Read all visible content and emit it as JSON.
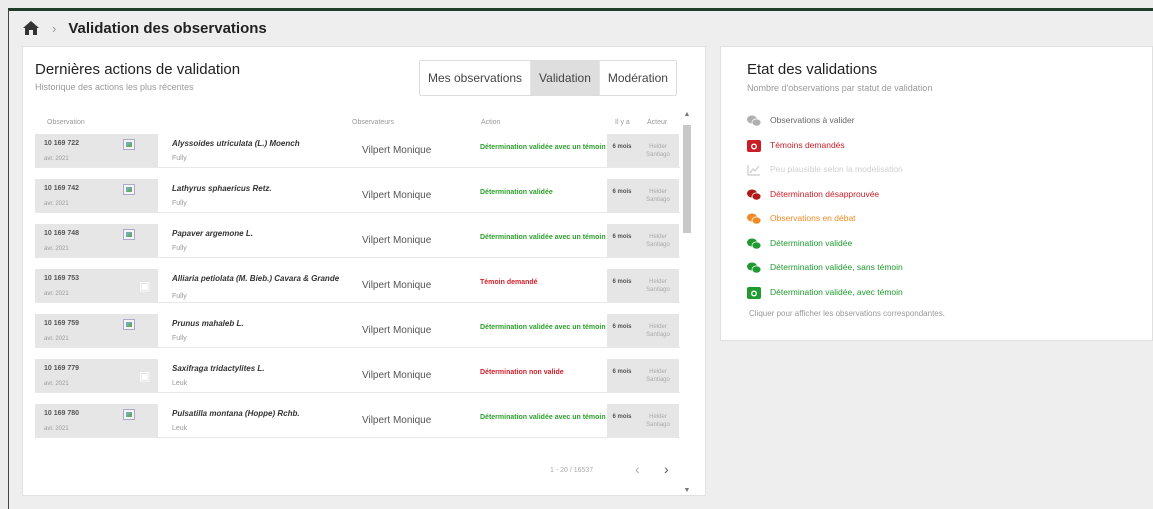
{
  "breadcrumb": {
    "title": "Validation des observations"
  },
  "left": {
    "title": "Dernières actions de validation",
    "subtitle": "Historique des actions les plus récentes",
    "tabs": [
      "Mes observations",
      "Validation",
      "Modération"
    ],
    "active_tab": "Validation",
    "columns": [
      "Observation",
      "Observateurs",
      "Action",
      "Il y a",
      "Acteur"
    ],
    "rows": [
      {
        "id": "10 169 722",
        "date": "avr. 2021",
        "species": "Alyssoides utriculata (L.) Moench",
        "place": "Fully",
        "observer": "Vilpert Monique",
        "action": "Détermination validée avec un témoin",
        "status": "green",
        "ago": "6 mois",
        "actor": "Helder Santiago",
        "media": "image"
      },
      {
        "id": "10 169 742",
        "date": "avr. 2021",
        "species": "Lathyrus sphaericus Retz.",
        "place": "Fully",
        "observer": "Vilpert Monique",
        "action": "Détermination validée",
        "status": "green",
        "ago": "6 mois",
        "actor": "Helder Santiago",
        "media": "image"
      },
      {
        "id": "10 169 748",
        "date": "avr. 2021",
        "species": "Papaver argemone L.",
        "place": "Fully",
        "observer": "Vilpert Monique",
        "action": "Détermination validée avec un témoin",
        "status": "green",
        "ago": "6 mois",
        "actor": "Helder Santiago",
        "media": "image"
      },
      {
        "id": "10 169 753",
        "date": "avr. 2021",
        "species": "Alliaria petiolata (M. Bieb.) Cavara & Grande",
        "place": "Fully",
        "observer": "Vilpert Monique",
        "action": "Témoin demandé",
        "status": "red",
        "ago": "6 mois",
        "actor": "Helder Santiago",
        "media": "camera"
      },
      {
        "id": "10 169 759",
        "date": "avr. 2021",
        "species": "Prunus mahaleb L.",
        "place": "Fully",
        "observer": "Vilpert Monique",
        "action": "Détermination validée avec un témoin",
        "status": "green",
        "ago": "6 mois",
        "actor": "Helder Santiago",
        "media": "image"
      },
      {
        "id": "10 169 779",
        "date": "avr. 2021",
        "species": "Saxifraga tridactylites L.",
        "place": "Leuk",
        "observer": "Vilpert Monique",
        "action": "Détermination non valide",
        "status": "red",
        "ago": "6 mois",
        "actor": "Helder Santiago",
        "media": "camera"
      },
      {
        "id": "10 169 780",
        "date": "avr. 2021",
        "species": "Pulsatilla montana (Hoppe) Rchb.",
        "place": "Leuk",
        "observer": "Vilpert Monique",
        "action": "Détermination validée avec un témoin",
        "status": "green",
        "ago": "6 mois",
        "actor": "Helder Santiago",
        "media": "image"
      }
    ],
    "pager": "1 - 20 / 16537"
  },
  "right": {
    "title": "Etat des validations",
    "subtitle": "Nombre d'observations par statut de validation",
    "items": [
      {
        "label": "Observations à valider",
        "color": "#666666",
        "icon": "chat-bubbles-icon",
        "icon_color": "#b0b0b0"
      },
      {
        "label": "Témoins demandés",
        "color": "#c81e28",
        "icon": "camera-icon",
        "icon_color": "#c81e28"
      },
      {
        "label": "Peu plausible selon la modélisation",
        "color": "#cfcfcf",
        "icon": "chart-icon",
        "icon_color": "#cccccc"
      },
      {
        "label": "Détermination désapprouvée",
        "color": "#c81e28",
        "icon": "chat-bubbles-icon",
        "icon_color": "#b01818"
      },
      {
        "label": "Observations en débat",
        "color": "#f08a24",
        "icon": "chat-bubbles-icon",
        "icon_color": "#f08a24"
      },
      {
        "label": "Détermination validée",
        "color": "#1f9a2e",
        "icon": "chat-bubbles-icon",
        "icon_color": "#1f9a2e"
      },
      {
        "label": "Détermination validée, sans témoin",
        "color": "#1f9a2e",
        "icon": "chat-bubbles-icon",
        "icon_color": "#1f9a2e"
      },
      {
        "label": "Détermination validée, avec témoin",
        "color": "#1f9a2e",
        "icon": "camera-icon",
        "icon_color": "#1f9a2e"
      }
    ],
    "hint": "Cliquer pour afficher les observations correspondantes."
  }
}
